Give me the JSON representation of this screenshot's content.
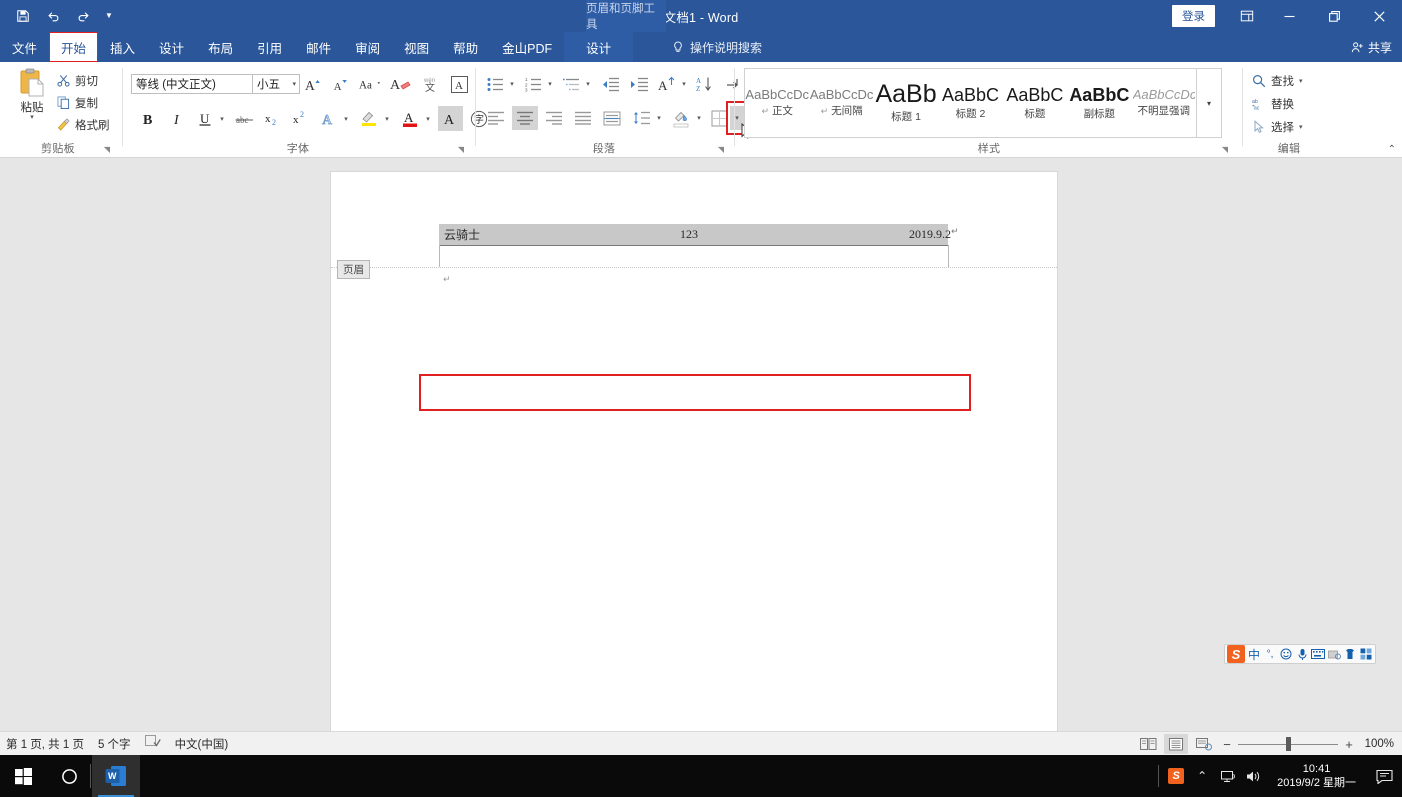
{
  "titlebar": {
    "document_title": "文档1  -  Word",
    "contextual_tools": "页眉和页脚工具",
    "signin_label": "登录",
    "quick_access": [
      {
        "name": "save",
        "glyph": "ὋE"
      },
      {
        "name": "undo",
        "glyph": "↶"
      },
      {
        "name": "redo",
        "glyph": "↷"
      },
      {
        "name": "customize",
        "glyph": "▾"
      }
    ],
    "window_buttons": {
      "minimize": "─",
      "restore": "❐",
      "close": "✕"
    }
  },
  "tabs": [
    {
      "label": "文件",
      "state": "normal"
    },
    {
      "label": "开始",
      "state": "active"
    },
    {
      "label": "插入",
      "state": "normal"
    },
    {
      "label": "设计",
      "state": "normal"
    },
    {
      "label": "布局",
      "state": "normal"
    },
    {
      "label": "引用",
      "state": "normal"
    },
    {
      "label": "邮件",
      "state": "normal"
    },
    {
      "label": "审阅",
      "state": "normal"
    },
    {
      "label": "视图",
      "state": "normal"
    },
    {
      "label": "帮助",
      "state": "normal"
    },
    {
      "label": "金山PDF",
      "state": "normal"
    },
    {
      "label": "设计",
      "state": "contextual"
    }
  ],
  "tellme": {
    "placeholder": "操作说明搜索"
  },
  "share": {
    "label": "共享"
  },
  "ribbon": {
    "clipboard": {
      "group_label": "剪贴板",
      "paste_label": "粘贴",
      "items": [
        {
          "label": "剪切",
          "icon": "scissors-icon"
        },
        {
          "label": "复制",
          "icon": "copy-icon"
        },
        {
          "label": "格式刷",
          "icon": "format-painter-icon"
        }
      ]
    },
    "font": {
      "group_label": "字体",
      "font_name": "等线 (中文正文)",
      "font_size": "小五",
      "row1": [
        "grow-font-icon",
        "shrink-font-icon",
        "change-case-icon",
        "clear-formatting-icon",
        "phonetic-guide-icon",
        "character-border-icon"
      ],
      "row2": [
        "bold-icon",
        "italic-icon",
        "underline-icon",
        "strikethrough-icon",
        "subscript-icon",
        "superscript-icon",
        "text-effects-icon",
        "highlight-icon",
        "font-color-icon",
        "character-shading-icon",
        "enclose-characters-icon"
      ]
    },
    "paragraph": {
      "group_label": "段落",
      "row1": [
        "bullets-icon",
        "numbering-icon",
        "multilevel-list-icon",
        "decrease-indent-icon",
        "increase-indent-icon",
        "sort-icon",
        "asian-layout-icon",
        "show-marks-icon"
      ],
      "row2": [
        "align-left-icon",
        "align-center-icon",
        "align-right-icon",
        "justify-icon",
        "distribute-icon",
        "line-spacing-icon",
        "shading-icon",
        "borders-icon"
      ],
      "active_button": "align-center-icon",
      "highlighted_button": "borders-icon"
    },
    "styles": {
      "group_label": "样式",
      "items": [
        {
          "preview": "AaBbCcDc",
          "name": "正文",
          "pilcrow": true,
          "size": 13,
          "weight": "normal",
          "italic": false,
          "color": "#7a7a7a"
        },
        {
          "preview": "AaBbCcDc",
          "name": "无间隔",
          "pilcrow": true,
          "size": 13,
          "weight": "normal",
          "italic": false,
          "color": "#7a7a7a"
        },
        {
          "preview": "AaBb",
          "name": "标题 1",
          "pilcrow": false,
          "size": 25,
          "weight": "normal",
          "italic": false,
          "color": "#1a1a1a"
        },
        {
          "preview": "AaBbC",
          "name": "标题 2",
          "pilcrow": false,
          "size": 18,
          "weight": "normal",
          "italic": false,
          "color": "#1a1a1a"
        },
        {
          "preview": "AaBbC",
          "name": "标题",
          "pilcrow": false,
          "size": 18,
          "weight": "normal",
          "italic": false,
          "color": "#1a1a1a"
        },
        {
          "preview": "AaBbC",
          "name": "副标题",
          "pilcrow": false,
          "size": 18,
          "weight": "bold",
          "italic": false,
          "color": "#1a1a1a"
        },
        {
          "preview": "AaBbCcDc",
          "name": "不明显强调",
          "pilcrow": false,
          "size": 13,
          "weight": "normal",
          "italic": true,
          "color": "#7a7a7a"
        }
      ]
    },
    "editing": {
      "group_label": "编辑",
      "items": [
        {
          "label": "查找",
          "icon": "search-icon",
          "caret": true
        },
        {
          "label": "替换",
          "icon": "replace-icon",
          "caret": false
        },
        {
          "label": "选择",
          "icon": "select-cursor-icon",
          "caret": true
        }
      ]
    }
  },
  "document": {
    "header_tag": "页眉",
    "header_left": "云骑士",
    "header_center": "123",
    "header_right": "2019.9.2"
  },
  "sogou_ime": {
    "logo": "S",
    "items": [
      "中",
      "°,",
      "☺",
      "\u0001",
      "⌨",
      "\u0002",
      "\u0003",
      "\u0004"
    ],
    "labels": [
      "chinese-mode",
      "punctuation-mode",
      "emoji-icon",
      "voice-input-icon",
      "soft-keyboard-icon",
      "screenshot-icon",
      "skin-icon",
      "toolbox-icon"
    ]
  },
  "statusbar": {
    "page_info": "第 1 页, 共 1 页",
    "word_count": "5 个字",
    "proofing_icon": "proofing-errors-icon",
    "language": "中文(中国)",
    "views": [
      "read-mode-icon",
      "print-layout-icon",
      "web-layout-icon"
    ],
    "active_view": "print-layout-icon",
    "zoom_out": "−",
    "zoom_in": "+",
    "zoom_level": "100%"
  },
  "taskbar": {
    "start": "start-icon",
    "search": "search-circle-icon",
    "apps": [
      {
        "name": "word-taskbar-icon",
        "letter": "W",
        "active": true
      }
    ],
    "tray": [
      "sogou-tray-icon",
      "show-hidden-icons-chevron",
      "network-icon",
      "volume-icon"
    ],
    "clock_time": "10:41",
    "clock_date": "2019/9/2 星期一",
    "action_center": "action-center-icon"
  },
  "colors": {
    "word_blue": "#2b579a",
    "highlight_red": "#e02020",
    "selection_gray": "#c8c8c8",
    "taskbar_black": "#0a0a0a"
  }
}
